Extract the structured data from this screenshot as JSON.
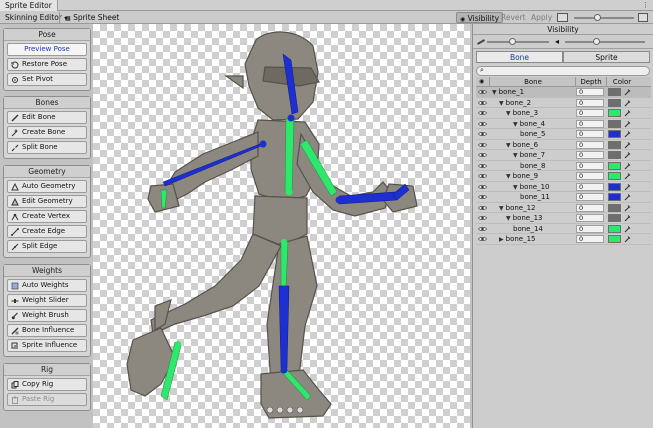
{
  "window": {
    "title": "Sprite Editor"
  },
  "toolbar": {
    "mode_dropdown": "Skinning Editor",
    "sprite_sheet": "Sprite Sheet",
    "visibility": "Visibility",
    "revert": "Revert",
    "apply": "Apply"
  },
  "tool_groups": [
    {
      "title": "Pose",
      "buttons": [
        {
          "label": "Preview Pose",
          "icon": "pose-icon",
          "active": true
        },
        {
          "label": "Restore Pose",
          "icon": "restore-icon"
        },
        {
          "label": "Set Pivot",
          "icon": "pivot-icon"
        }
      ]
    },
    {
      "title": "Bones",
      "buttons": [
        {
          "label": "Edit Bone",
          "icon": "bone-edit-icon"
        },
        {
          "label": "Create Bone",
          "icon": "bone-create-icon"
        },
        {
          "label": "Split Bone",
          "icon": "bone-split-icon"
        }
      ]
    },
    {
      "title": "Geometry",
      "buttons": [
        {
          "label": "Auto Geometry",
          "icon": "auto-geometry-icon"
        },
        {
          "label": "Edit Geometry",
          "icon": "edit-geometry-icon"
        },
        {
          "label": "Create Vertex",
          "icon": "vertex-icon"
        },
        {
          "label": "Create Edge",
          "icon": "edge-icon"
        },
        {
          "label": "Split Edge",
          "icon": "split-edge-icon"
        }
      ]
    },
    {
      "title": "Weights",
      "buttons": [
        {
          "label": "Auto Weights",
          "icon": "auto-weights-icon"
        },
        {
          "label": "Weight Slider",
          "icon": "weight-slider-icon"
        },
        {
          "label": "Weight Brush",
          "icon": "brush-icon"
        },
        {
          "label": "Bone Influence",
          "icon": "bone-influence-icon"
        },
        {
          "label": "Sprite Influence",
          "icon": "sprite-influence-icon"
        }
      ]
    },
    {
      "title": "Rig",
      "buttons": [
        {
          "label": "Copy Rig",
          "icon": "copy-icon"
        },
        {
          "label": "Paste Rig",
          "icon": "paste-icon",
          "disabled": true
        }
      ]
    }
  ],
  "visibility_panel": {
    "title": "Visibility",
    "tabs": [
      "Bone",
      "Sprite"
    ],
    "active_tab": "Bone",
    "columns": {
      "bone": "Bone",
      "depth": "Depth",
      "color": "Color"
    },
    "bones": [
      {
        "name": "bone_1",
        "level": 0,
        "expanded": true,
        "depth": "0",
        "color": "#6e6e6e",
        "selected": true
      },
      {
        "name": "bone_2",
        "level": 1,
        "expanded": true,
        "depth": "0",
        "color": "#6e6e6e"
      },
      {
        "name": "bone_3",
        "level": 2,
        "expanded": true,
        "depth": "0",
        "color": "#2ee86b"
      },
      {
        "name": "bone_4",
        "level": 3,
        "expanded": true,
        "depth": "0",
        "color": "#6e6e6e"
      },
      {
        "name": "bone_5",
        "level": 4,
        "expanded": null,
        "depth": "0",
        "color": "#1d2fd1"
      },
      {
        "name": "bone_6",
        "level": 2,
        "expanded": true,
        "depth": "0",
        "color": "#6e6e6e"
      },
      {
        "name": "bone_7",
        "level": 3,
        "expanded": true,
        "depth": "0",
        "color": "#6e6e6e"
      },
      {
        "name": "bone_8",
        "level": 4,
        "expanded": null,
        "depth": "0",
        "color": "#2ee86b"
      },
      {
        "name": "bone_9",
        "level": 2,
        "expanded": true,
        "depth": "0",
        "color": "#2ee86b"
      },
      {
        "name": "bone_10",
        "level": 3,
        "expanded": true,
        "depth": "0",
        "color": "#1d2fd1"
      },
      {
        "name": "bone_11",
        "level": 4,
        "expanded": null,
        "depth": "0",
        "color": "#1d2fd1"
      },
      {
        "name": "bone_12",
        "level": 1,
        "expanded": true,
        "depth": "0",
        "color": "#6e6e6e"
      },
      {
        "name": "bone_13",
        "level": 2,
        "expanded": true,
        "depth": "0",
        "color": "#6e6e6e"
      },
      {
        "name": "bone_14",
        "level": 3,
        "expanded": null,
        "depth": "0",
        "color": "#2ee86b"
      },
      {
        "name": "bone_15",
        "level": 1,
        "expanded": false,
        "depth": "0",
        "color": "#2ee86b"
      }
    ]
  },
  "colors": {
    "bone_blue": "#1d2fd1",
    "bone_green": "#2ee86b",
    "sprite": "#8a857c",
    "accent": "#1a3aa8"
  }
}
